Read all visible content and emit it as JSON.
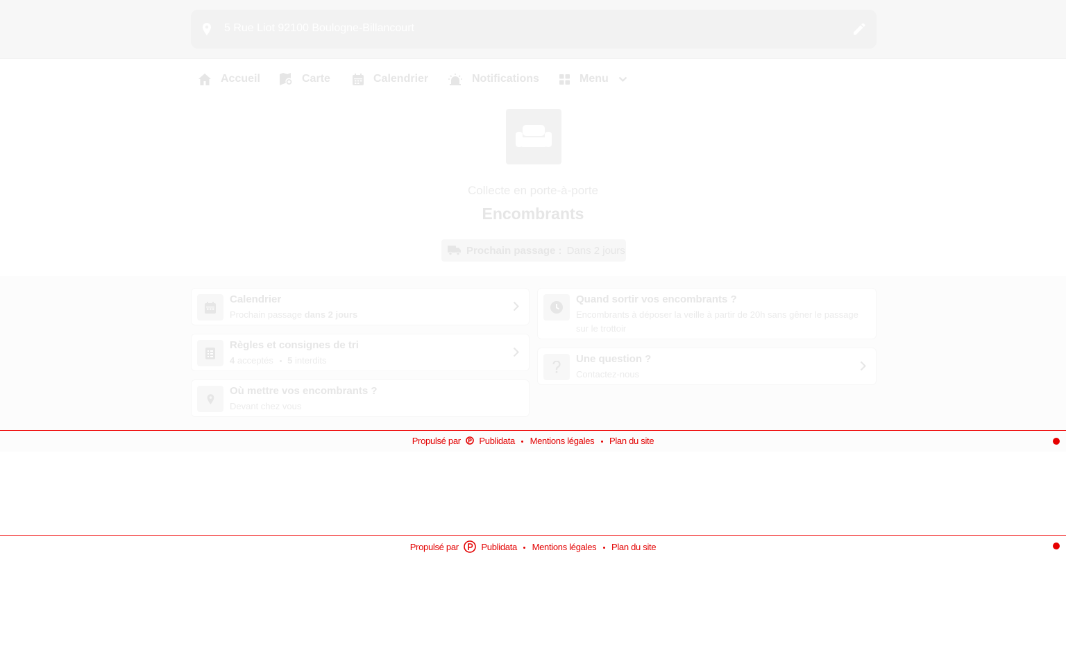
{
  "address": {
    "text": "5 Rue Liot 92100 Boulogne-Billancourt"
  },
  "nav": {
    "items": [
      {
        "label": "Accueil",
        "icon": "home-icon"
      },
      {
        "label": "Carte",
        "icon": "map-icon"
      },
      {
        "label": "Calendrier",
        "icon": "calendar-icon"
      },
      {
        "label": "Notifications",
        "icon": "alarm-icon"
      },
      {
        "label": "Menu",
        "icon": "grid-icon"
      }
    ]
  },
  "hero": {
    "icon": "sofa-icon",
    "subtitle": "Collecte en porte-à-porte",
    "title": "Encombrants",
    "badge_label": "Prochain passage :",
    "badge_value": "Dans 2 jours"
  },
  "cards": {
    "calendar": {
      "title": "Calendrier",
      "desc_prefix": "Prochain passage",
      "desc_bold": "dans 2 jours"
    },
    "rules": {
      "title": "Règles et consignes de tri",
      "accepted_count": "4",
      "accepted_label": "acceptés",
      "refused_count": "5",
      "refused_label": "interdits"
    },
    "where": {
      "title": "Où mettre vos encombrants ?",
      "desc": "Devant chez vous"
    },
    "when": {
      "title": "Quand sortir vos encombrants ?",
      "desc": "Encombrants à déposer la veille à partir de 20h sans gêner le passage sur le trottoir"
    },
    "question": {
      "title": "Une question ?",
      "desc": "Contactez-nous"
    }
  },
  "footer": {
    "powered_by": "Propulsé par",
    "brand": "Publidata",
    "legal": "Mentions légales",
    "sitemap": "Plan du site"
  },
  "colors": {
    "accent": "#e30000",
    "muted_text": "#e6e6e6"
  }
}
